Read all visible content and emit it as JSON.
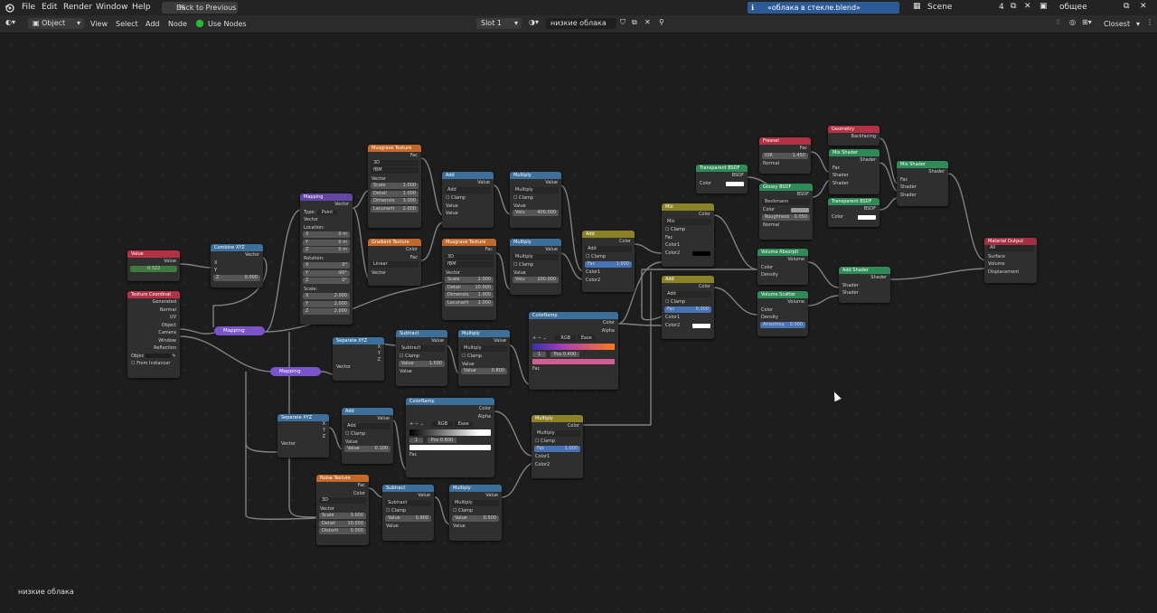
{
  "menu": {
    "items": [
      "File",
      "Edit",
      "Render",
      "Window",
      "Help"
    ],
    "back_button": "Back to Previous",
    "notice": "«облака в стекле.blend» сохранено",
    "scene_label": "Scene",
    "scene_number": "4",
    "view_layer": "общее"
  },
  "toolbar": {
    "mode": "Object",
    "view": "View",
    "select": "Select",
    "add": "Add",
    "node": "Node",
    "use_nodes": "Use Nodes",
    "slot": "Slot 1",
    "material": "низкие облака",
    "snap": "Closest"
  },
  "status_label": "низкие облака",
  "nodes": {
    "value": {
      "title": "Value",
      "out": "Value",
      "val": "0.322"
    },
    "texcoord": {
      "title": "Texture Coordinat",
      "outs": [
        "Generated",
        "Normal",
        "UV",
        "Object",
        "Camera",
        "Window",
        "Reflection"
      ],
      "object": "Objec",
      "instancer": "From Instancer"
    },
    "combine": {
      "title": "Combine XYZ",
      "out": "Vector",
      "x": "X",
      "y": "Y",
      "z": "Z",
      "zval": "0.000"
    },
    "mapping_pill1": "Mapping",
    "mapping_pill2": "Mapping",
    "mapping": {
      "title": "Mapping",
      "out": "Vector",
      "type_label": "Type:",
      "type_val": "Point",
      "vector": "Vector",
      "location": "Location:",
      "lx": "0 m",
      "ly": "0 m",
      "lz": "0 m",
      "rotation": "Rotation:",
      "rx": "0°",
      "ry": "-90°",
      "rz": "0°",
      "scale": "Scale:",
      "sx": "2.000",
      "sy": "2.000",
      "sz": "2.000"
    },
    "musgrave1": {
      "title": "Musgrave Texture",
      "out": "Fac",
      "dim": "3D",
      "type": "fBM",
      "vector": "Vector",
      "scale": "1.000",
      "detail": "1.000",
      "dimension": "3.000",
      "lacunarity": "2.000"
    },
    "gradient": {
      "title": "Gradient Texture",
      "outs": [
        "Color",
        "Fac"
      ],
      "type": "Linear",
      "vector": "Vector"
    },
    "add1": {
      "title": "Add",
      "out": "Value",
      "op": "Add",
      "clamp": "Clamp",
      "in1": "Value",
      "in2": "Value"
    },
    "mult1": {
      "title": "Multiply",
      "out": "Value",
      "op": "Multiply",
      "clamp": "Clamp",
      "in1": "Value",
      "val": "400.000"
    },
    "musgrave2": {
      "title": "Musgrave Texture",
      "out": "Fac",
      "dim": "3D",
      "type": "fBM",
      "vector": "Vector",
      "scale": "2.000",
      "detail": "10.000",
      "dimension": "1.000",
      "lacunarity": "2.000"
    },
    "mult2": {
      "title": "Multiply",
      "out": "Value",
      "op": "Multiply",
      "clamp": "Clamp",
      "in1": "Value",
      "val": "100.000"
    },
    "add_col": {
      "title": "Add",
      "out": "Color",
      "op": "Add",
      "clamp": "Clamp",
      "fac": "1.000",
      "c1": "Color1",
      "c2": "Color2"
    },
    "mix": {
      "title": "Mix",
      "out": "Color",
      "op": "Mix",
      "clamp": "Clamp",
      "fac": "Fac",
      "c1": "Color1",
      "c2": "Color2"
    },
    "add_col2": {
      "title": "Add",
      "out": "Color",
      "op": "Add",
      "clamp": "Clamp",
      "fac": "0.300",
      "c1": "Color1",
      "c2": "Color2"
    },
    "sep1": {
      "title": "Separate XYZ",
      "outs": [
        "X",
        "Y",
        "Z"
      ],
      "in": "Vector"
    },
    "sub1": {
      "title": "Subtract",
      "out": "Value",
      "op": "Subtract",
      "clamp": "Clamp",
      "val": "1.500",
      "in2": "Value"
    },
    "mult3": {
      "title": "Multiply",
      "out": "Value",
      "op": "Multiply",
      "clamp": "Clamp",
      "in1": "Value",
      "val": "0.800"
    },
    "ramp1": {
      "title": "ColorRamp",
      "outs": [
        "Color",
        "Alpha"
      ],
      "mode": "RGB",
      "interp": "Ease",
      "idx": "1",
      "pos": "0.400",
      "fac": "Fac"
    },
    "sep2": {
      "title": "Separate XYZ",
      "outs": [
        "X",
        "Y",
        "Z"
      ],
      "in": "Vector"
    },
    "add2": {
      "title": "Add",
      "out": "Value",
      "op": "Add",
      "clamp": "Clamp",
      "in1": "Value",
      "val": "0.100"
    },
    "ramp2": {
      "title": "ColorRamp",
      "outs": [
        "Color",
        "Alpha"
      ],
      "mode": "RGB",
      "interp": "Ease",
      "idx": "1",
      "pos": "0.800",
      "fac": "Fac"
    },
    "mult_col": {
      "title": "Multiply",
      "out": "Color",
      "op": "Multiply",
      "clamp": "Clamp",
      "fac": "1.000",
      "c1": "Color1",
      "c2": "Color2"
    },
    "noise": {
      "title": "Noise Texture",
      "outs": [
        "Fac",
        "Color"
      ],
      "dim": "3D",
      "vector": "Vector",
      "scale": "3.000",
      "detail": "10.000",
      "distortion": "0.000"
    },
    "sub2": {
      "title": "Subtract",
      "out": "Value",
      "op": "Subtract",
      "clamp": "Clamp",
      "val": "0.900",
      "in2": "Value"
    },
    "mult4": {
      "title": "Multiply",
      "out": "Value",
      "op": "Multiply",
      "clamp": "Clamp",
      "val": "0.500",
      "in2": "Value"
    },
    "transp1": {
      "title": "Transparent BSDF",
      "out": "BSDF",
      "color": "Color"
    },
    "fresnel": {
      "title": "Fresnel",
      "out": "Fac",
      "ior": "1.450",
      "normal": "Normal"
    },
    "glossy": {
      "title": "Glossy BSDF",
      "out": "BSDF",
      "dist": "Beckmann",
      "color": "Color",
      "roughness": "0.050",
      "normal": "Normal"
    },
    "geometry": {
      "title": "Geometry",
      "out": "Backfacing"
    },
    "mixsh1": {
      "title": "Mix Shader",
      "out": "Shader",
      "fac": "Fac",
      "s1": "Shader",
      "s2": "Shader"
    },
    "transp2": {
      "title": "Transparent BSDF",
      "out": "BSDF",
      "color": "Color"
    },
    "mixsh2": {
      "title": "Mix Shader",
      "out": "Shader",
      "fac": "Fac",
      "s1": "Shader",
      "s2": "Shader"
    },
    "vabs": {
      "title": "Volume Absorpti",
      "out": "Volume",
      "color": "Color",
      "density": "Density"
    },
    "vscat": {
      "title": "Volume Scatter",
      "out": "Volume",
      "color": "Color",
      "density": "Density",
      "aniso": "0.000"
    },
    "addsh": {
      "title": "Add Shader",
      "out": "Shader",
      "s1": "Shader",
      "s2": "Shader"
    },
    "output": {
      "title": "Material Output",
      "target": "All",
      "surface": "Surface",
      "volume": "Volume",
      "displacement": "Displacement"
    }
  }
}
